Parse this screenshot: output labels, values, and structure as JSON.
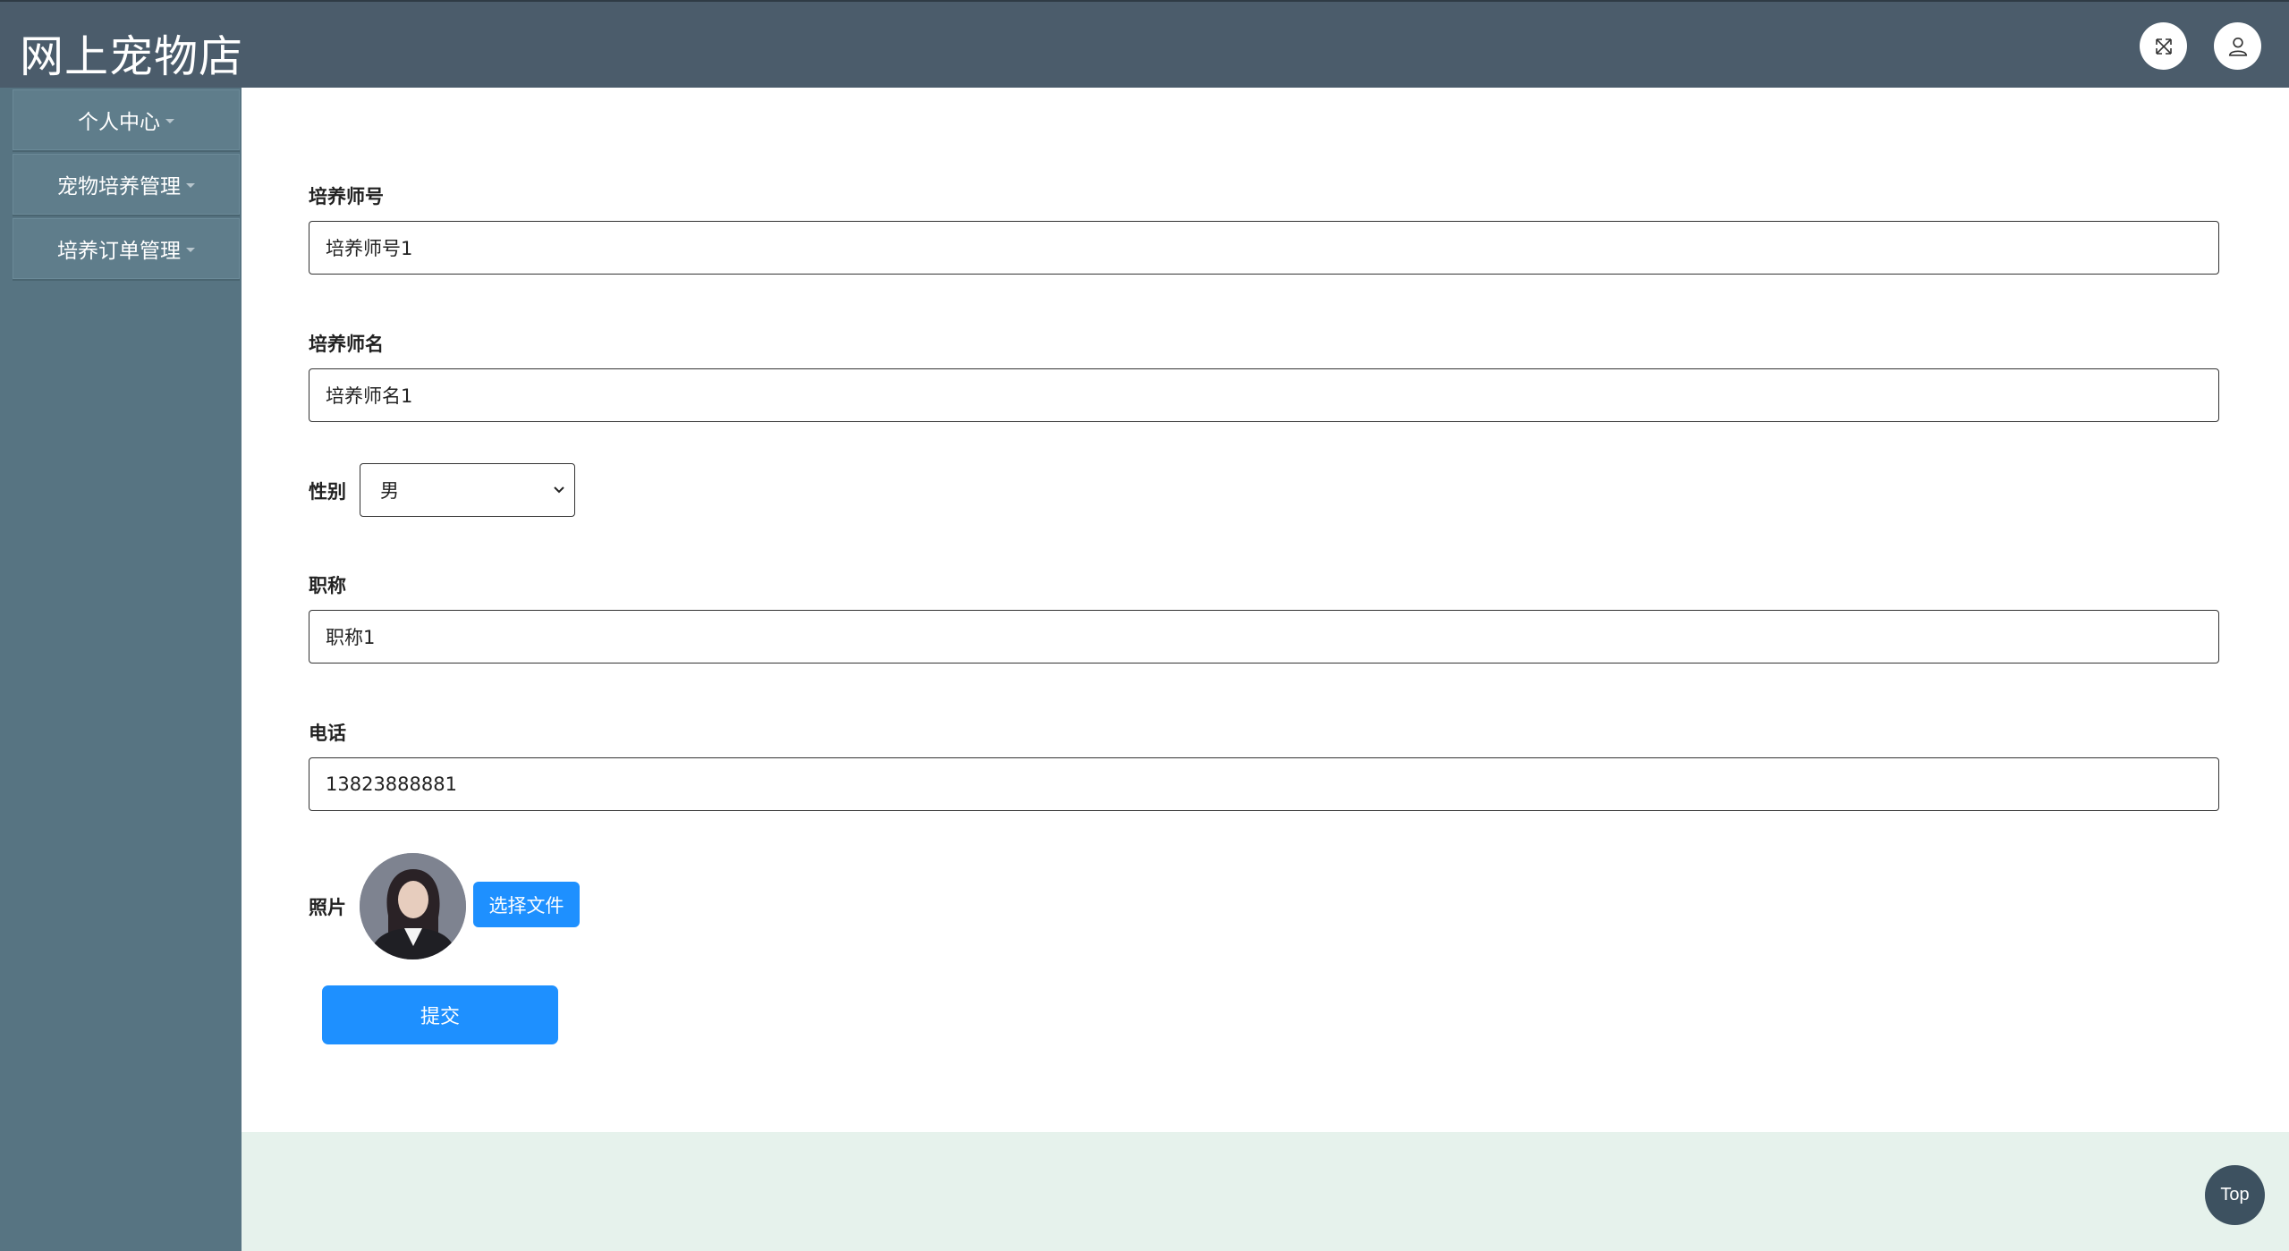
{
  "header": {
    "app_title": "网上宠物店",
    "fullscreen_icon": "fullscreen-expand-icon",
    "user_icon": "user-icon"
  },
  "sidebar": {
    "items": [
      {
        "label": "个人中心"
      },
      {
        "label": "宠物培养管理"
      },
      {
        "label": "培养订单管理"
      }
    ]
  },
  "form": {
    "trainer_id": {
      "label": "培养师号",
      "value": "培养师号1"
    },
    "trainer_name": {
      "label": "培养师名",
      "value": "培养师名1"
    },
    "gender": {
      "label": "性别",
      "selected": "男"
    },
    "title": {
      "label": "职称",
      "value": "职称1"
    },
    "phone": {
      "label": "电话",
      "value": "13823888881"
    },
    "photo": {
      "label": "照片",
      "choose_file_label": "选择文件"
    },
    "submit_label": "提交"
  },
  "back_to_top_label": "Top",
  "colors": {
    "header_bg": "#4b5c6b",
    "sidebar_bg": "#577482",
    "primary_button": "#1e90ff",
    "footer_bg": "#e6f2ec"
  }
}
